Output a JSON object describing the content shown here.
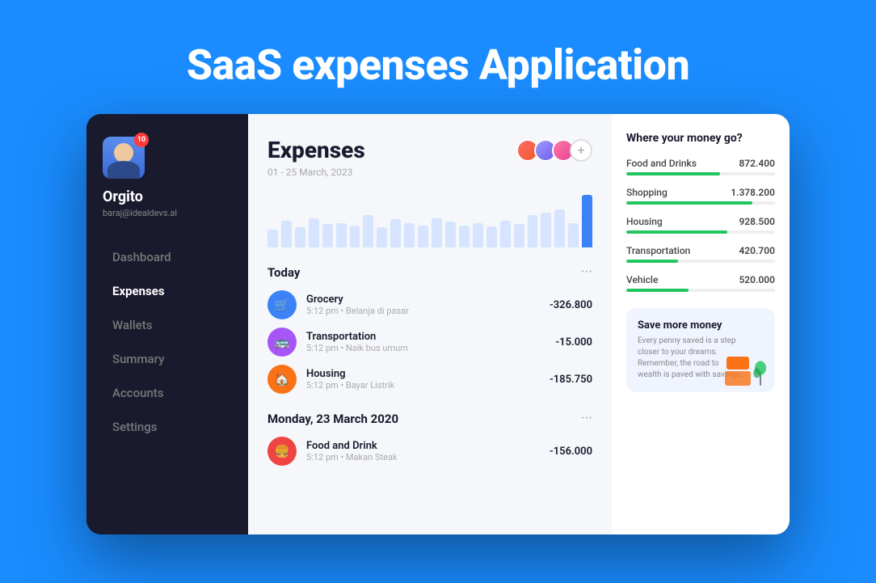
{
  "page": {
    "hero_title": "SaaS expenses Application"
  },
  "sidebar": {
    "user": {
      "name": "Orgito",
      "email": "baraj@idealdevs.al",
      "notification_count": "10"
    },
    "nav_items": [
      {
        "label": "Dashboard",
        "active": false
      },
      {
        "label": "Expenses",
        "active": true
      },
      {
        "label": "Wallets",
        "active": false
      },
      {
        "label": "Summary",
        "active": false
      },
      {
        "label": "Accounts",
        "active": false
      },
      {
        "label": "Settings",
        "active": false
      }
    ]
  },
  "expenses": {
    "title": "Expenses",
    "date_range": "01 - 25 March, 2023",
    "chart": {
      "bars": [
        30,
        45,
        35,
        50,
        40,
        42,
        38,
        55,
        35,
        48,
        42,
        38,
        50,
        44,
        38,
        42,
        36,
        45,
        40,
        55,
        60,
        65,
        42,
        90
      ]
    },
    "sections": [
      {
        "title": "Today",
        "transactions": [
          {
            "name": "Grocery",
            "meta": "5:12 pm • Belanja di pasar",
            "amount": "-326.800",
            "icon": "🛒",
            "icon_class": "icon-grocery"
          },
          {
            "name": "Transportation",
            "meta": "5:12 pm • Naik bus umum",
            "amount": "-15.000",
            "icon": "🚌",
            "icon_class": "icon-transport"
          },
          {
            "name": "Housing",
            "meta": "5:12 pm • Bayar Listrik",
            "amount": "-185.750",
            "icon": "🏠",
            "icon_class": "icon-housing"
          }
        ]
      },
      {
        "title": "Monday, 23 March 2020",
        "transactions": [
          {
            "name": "Food and Drink",
            "meta": "5:12 pm • Makan Steak",
            "amount": "-156.000",
            "icon": "🍔",
            "icon_class": "icon-food"
          }
        ]
      }
    ]
  },
  "money_panel": {
    "title": "Where your money go?",
    "categories": [
      {
        "name": "Food and Drinks",
        "amount": "872.400",
        "percent": 63
      },
      {
        "name": "Shopping",
        "amount": "1.378.200",
        "percent": 85
      },
      {
        "name": "Housing",
        "amount": "928.500",
        "percent": 68
      },
      {
        "name": "Transportation",
        "amount": "420.700",
        "percent": 35
      },
      {
        "name": "Vehicle",
        "amount": "520.000",
        "percent": 42
      }
    ],
    "save_card": {
      "title": "Save more money",
      "description": "Every penny saved is a step closer to your dreams. Remember, the road to wealth is paved with savings."
    }
  }
}
